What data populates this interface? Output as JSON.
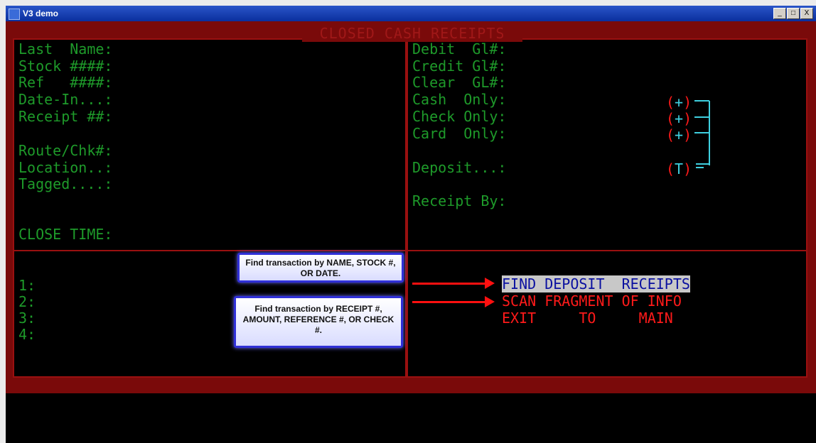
{
  "window": {
    "title": "V3 demo",
    "buttons": [
      "_",
      "□",
      "X"
    ]
  },
  "screen_title": "CLOSED CASH RECEIPTS",
  "left_fields": [
    "Last  Name:",
    "Stock ####:",
    "Ref   ####:",
    "Date-In...:",
    "Receipt ##:",
    "Route/Chk#:",
    "Location..:",
    "Tagged....:",
    "CLOSE TIME:"
  ],
  "right_fields": [
    "Debit  Gl#:",
    "Credit Gl#:",
    "Clear  GL#:",
    "Cash  Only:",
    "Check Only:",
    "Card  Only:",
    "Deposit...:",
    "Receipt By:"
  ],
  "totals": {
    "open": "(",
    "close": ")",
    "plus": "+",
    "t": "T"
  },
  "options": [
    "1:",
    "2:",
    "3:",
    "4:"
  ],
  "callouts": {
    "first": "Find transaction by NAME, STOCK #, OR DATE.",
    "second": "Find transaction by RECEIPT #, AMOUNT, REFERENCE #, OR CHECK #."
  },
  "menu": [
    "FIND DEPOSIT  RECEIPTS",
    "SCAN FRAGMENT OF INFO",
    "EXIT     TO     MAIN"
  ],
  "colors": {
    "green": "#1e9a2a",
    "red": "#ff1a1a",
    "border": "#7a0a0a",
    "cyan": "#3fd0e0",
    "highlight_bg": "#c8c8c8",
    "highlight_fg": "#0a10a0"
  }
}
